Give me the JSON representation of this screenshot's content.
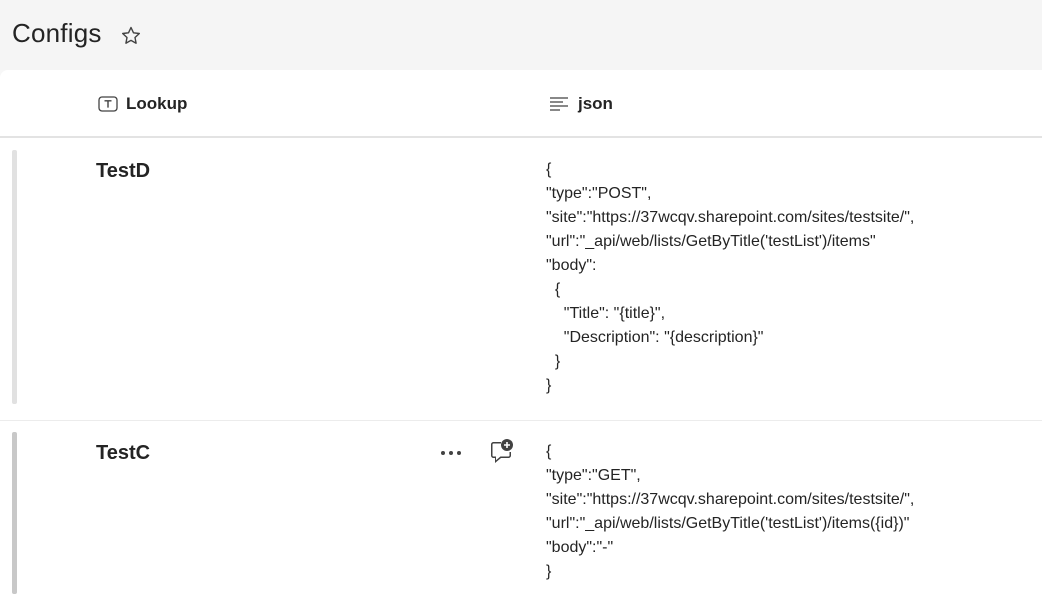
{
  "page": {
    "title": "Configs",
    "star_icon": "star-outline-icon"
  },
  "columns": [
    {
      "label": "Lookup",
      "icon": "text-column-icon"
    },
    {
      "label": "json",
      "icon": "multiline-text-icon"
    }
  ],
  "rows": [
    {
      "lookup": "TestD",
      "json": "{\n\"type\":\"POST\",\n\"site\":\"https://37wcqv.sharepoint.com/sites/testsite/\",\n\"url\":\"_api/web/lists/GetByTitle('testList')/items\"\n\"body\":\n  {\n    \"Title\": \"{title}\",\n    \"Description\": \"{description}\"\n  }\n}"
    },
    {
      "lookup": "TestC",
      "json": "{\n\"type\":\"GET\",\n\"site\":\"https://37wcqv.sharepoint.com/sites/testsite/\",\n\"url\":\"_api/web/lists/GetByTitle('testList')/items({id})\"\n\"body\":\"-\"\n}",
      "actions": [
        "more-options-icon",
        "add-comment-icon"
      ]
    }
  ]
}
